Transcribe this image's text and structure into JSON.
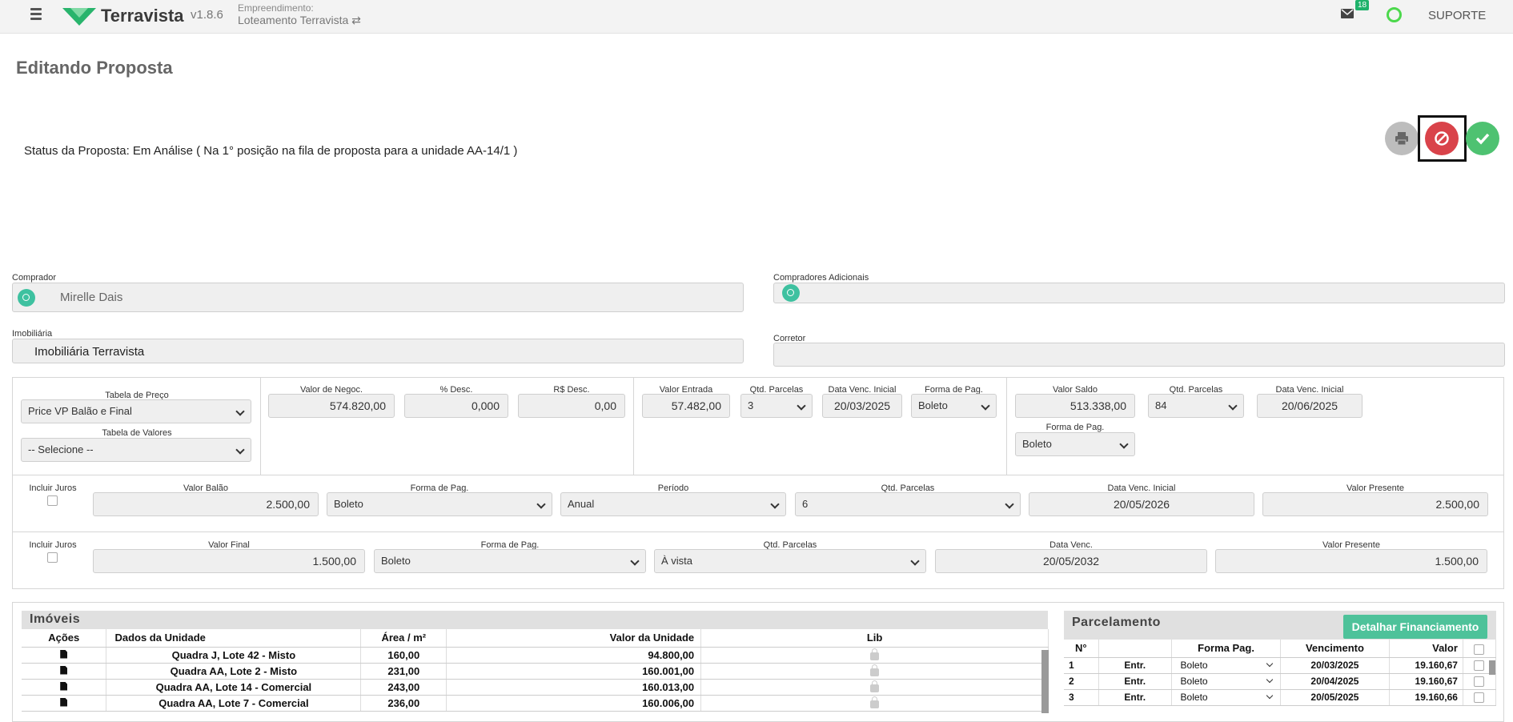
{
  "header": {
    "app_name": "Terravista",
    "version": "v1.8.6",
    "empreendimento_label": "Empreendimento:",
    "empreendimento_value": "Loteamento Terravista ⇄",
    "mail_count": "18",
    "support_label": "SUPORTE",
    "accent_color": "#1fb26b"
  },
  "page": {
    "title": "Editando Proposta",
    "status": "Status da Proposta: Em Análise ( Na 1° posição na fila de proposta para a unidade AA-14/1 )"
  },
  "actions": {
    "print_icon": "print-icon",
    "cancel_icon": "ban-icon",
    "confirm_icon": "check-icon"
  },
  "form": {
    "comprador_label": "Comprador",
    "comprador_value": "Mirelle Dais",
    "compradores_adicionais_label": "Compradores Adicionais",
    "compradores_adicionais_value": "",
    "imobiliaria_label": "Imobiliária",
    "imobiliaria_value": "Imobiliária Terravista",
    "corretor_label": "Corretor",
    "corretor_value": ""
  },
  "pricing": {
    "tabela_preco_label": "Tabela de Preço",
    "tabela_preco_value": "Price VP Balão e Final",
    "tabela_valores_label": "Tabela de Valores",
    "tabela_valores_value": "-- Selecione --",
    "valor_negoc_label": "Valor de Negoc.",
    "valor_negoc_value": "574.820,00",
    "pct_desc_label": "% Desc.",
    "pct_desc_value": "0,000",
    "rs_desc_label": "R$ Desc.",
    "rs_desc_value": "0,00",
    "entrada": {
      "valor_label": "Valor Entrada",
      "valor_value": "57.482,00",
      "qtd_label": "Qtd. Parcelas",
      "qtd_value": "3",
      "data_label": "Data Venc. Inicial",
      "data_value": "20/03/2025",
      "forma_label": "Forma de Pag.",
      "forma_value": "Boleto"
    },
    "saldo": {
      "valor_label": "Valor Saldo",
      "valor_value": "513.338,00",
      "qtd_label": "Qtd. Parcelas",
      "qtd_value": "84",
      "data_label": "Data Venc. Inicial",
      "data_value": "20/06/2025",
      "forma_label": "Forma de Pag.",
      "forma_value": "Boleto"
    }
  },
  "balao": {
    "juros_label": "Incluir Juros",
    "valor_label": "Valor Balão",
    "valor_value": "2.500,00",
    "forma_label": "Forma de Pag.",
    "forma_value": "Boleto",
    "periodo_label": "Período",
    "periodo_value": "Anual",
    "qtd_label": "Qtd. Parcelas",
    "qtd_value": "6",
    "data_label": "Data Venc. Inicial",
    "data_value": "20/05/2026",
    "vp_label": "Valor Presente",
    "vp_value": "2.500,00"
  },
  "final": {
    "juros_label": "Incluir Juros",
    "valor_label": "Valor Final",
    "valor_value": "1.500,00",
    "forma_label": "Forma de Pag.",
    "forma_value": "Boleto",
    "qtd_label": "Qtd. Parcelas",
    "qtd_value": "À vista",
    "data_label": "Data Venc.",
    "data_value": "20/05/2032",
    "vp_label": "Valor Presente",
    "vp_value": "1.500,00"
  },
  "imoveis": {
    "title": "Imóveis",
    "columns": [
      "Ações",
      "Dados da Unidade",
      "Área / m²",
      "Valor da Unidade",
      "Lib"
    ],
    "rows": [
      {
        "unidade": "Quadra J, Lote 42 - Misto",
        "area": "160,00",
        "valor": "94.800,00"
      },
      {
        "unidade": "Quadra AA, Lote 2 - Misto",
        "area": "231,00",
        "valor": "160.001,00"
      },
      {
        "unidade": "Quadra AA, Lote 14 - Comercial",
        "area": "243,00",
        "valor": "160.013,00"
      },
      {
        "unidade": "Quadra AA, Lote 7 - Comercial",
        "area": "236,00",
        "valor": "160.006,00"
      }
    ]
  },
  "parcelamento": {
    "title": "Parcelamento",
    "detalhar_label": "Detalhar Financiamento",
    "columns": [
      "N°",
      "",
      "Forma Pag.",
      "Vencimento",
      "Valor"
    ],
    "rows": [
      {
        "n": "1",
        "tipo": "Entr.",
        "forma": "Boleto",
        "venc": "20/03/2025",
        "valor": "19.160,67"
      },
      {
        "n": "2",
        "tipo": "Entr.",
        "forma": "Boleto",
        "venc": "20/04/2025",
        "valor": "19.160,67"
      },
      {
        "n": "3",
        "tipo": "Entr.",
        "forma": "Boleto",
        "venc": "20/05/2025",
        "valor": "19.160,66"
      }
    ]
  }
}
